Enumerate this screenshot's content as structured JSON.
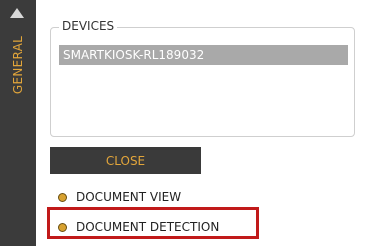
{
  "sidebar": {
    "tab_label": "GENERAL",
    "collapse_icon": "triangle-up-icon"
  },
  "devices": {
    "legend": "DEVICES",
    "items": [
      "SMARTKIOSK-RL189032"
    ]
  },
  "buttons": {
    "close_label": "CLOSE"
  },
  "options": [
    {
      "label": "DOCUMENT VIEW",
      "icon": "bullet-icon"
    },
    {
      "label": "DOCUMENT DETECTION",
      "icon": "bullet-icon",
      "highlighted": true
    }
  ],
  "colors": {
    "sidebar_bg": "#3b3b3b",
    "accent": "#e2a53a",
    "selection_bg": "#a9a9a9",
    "highlight_border": "#c11a1a"
  }
}
